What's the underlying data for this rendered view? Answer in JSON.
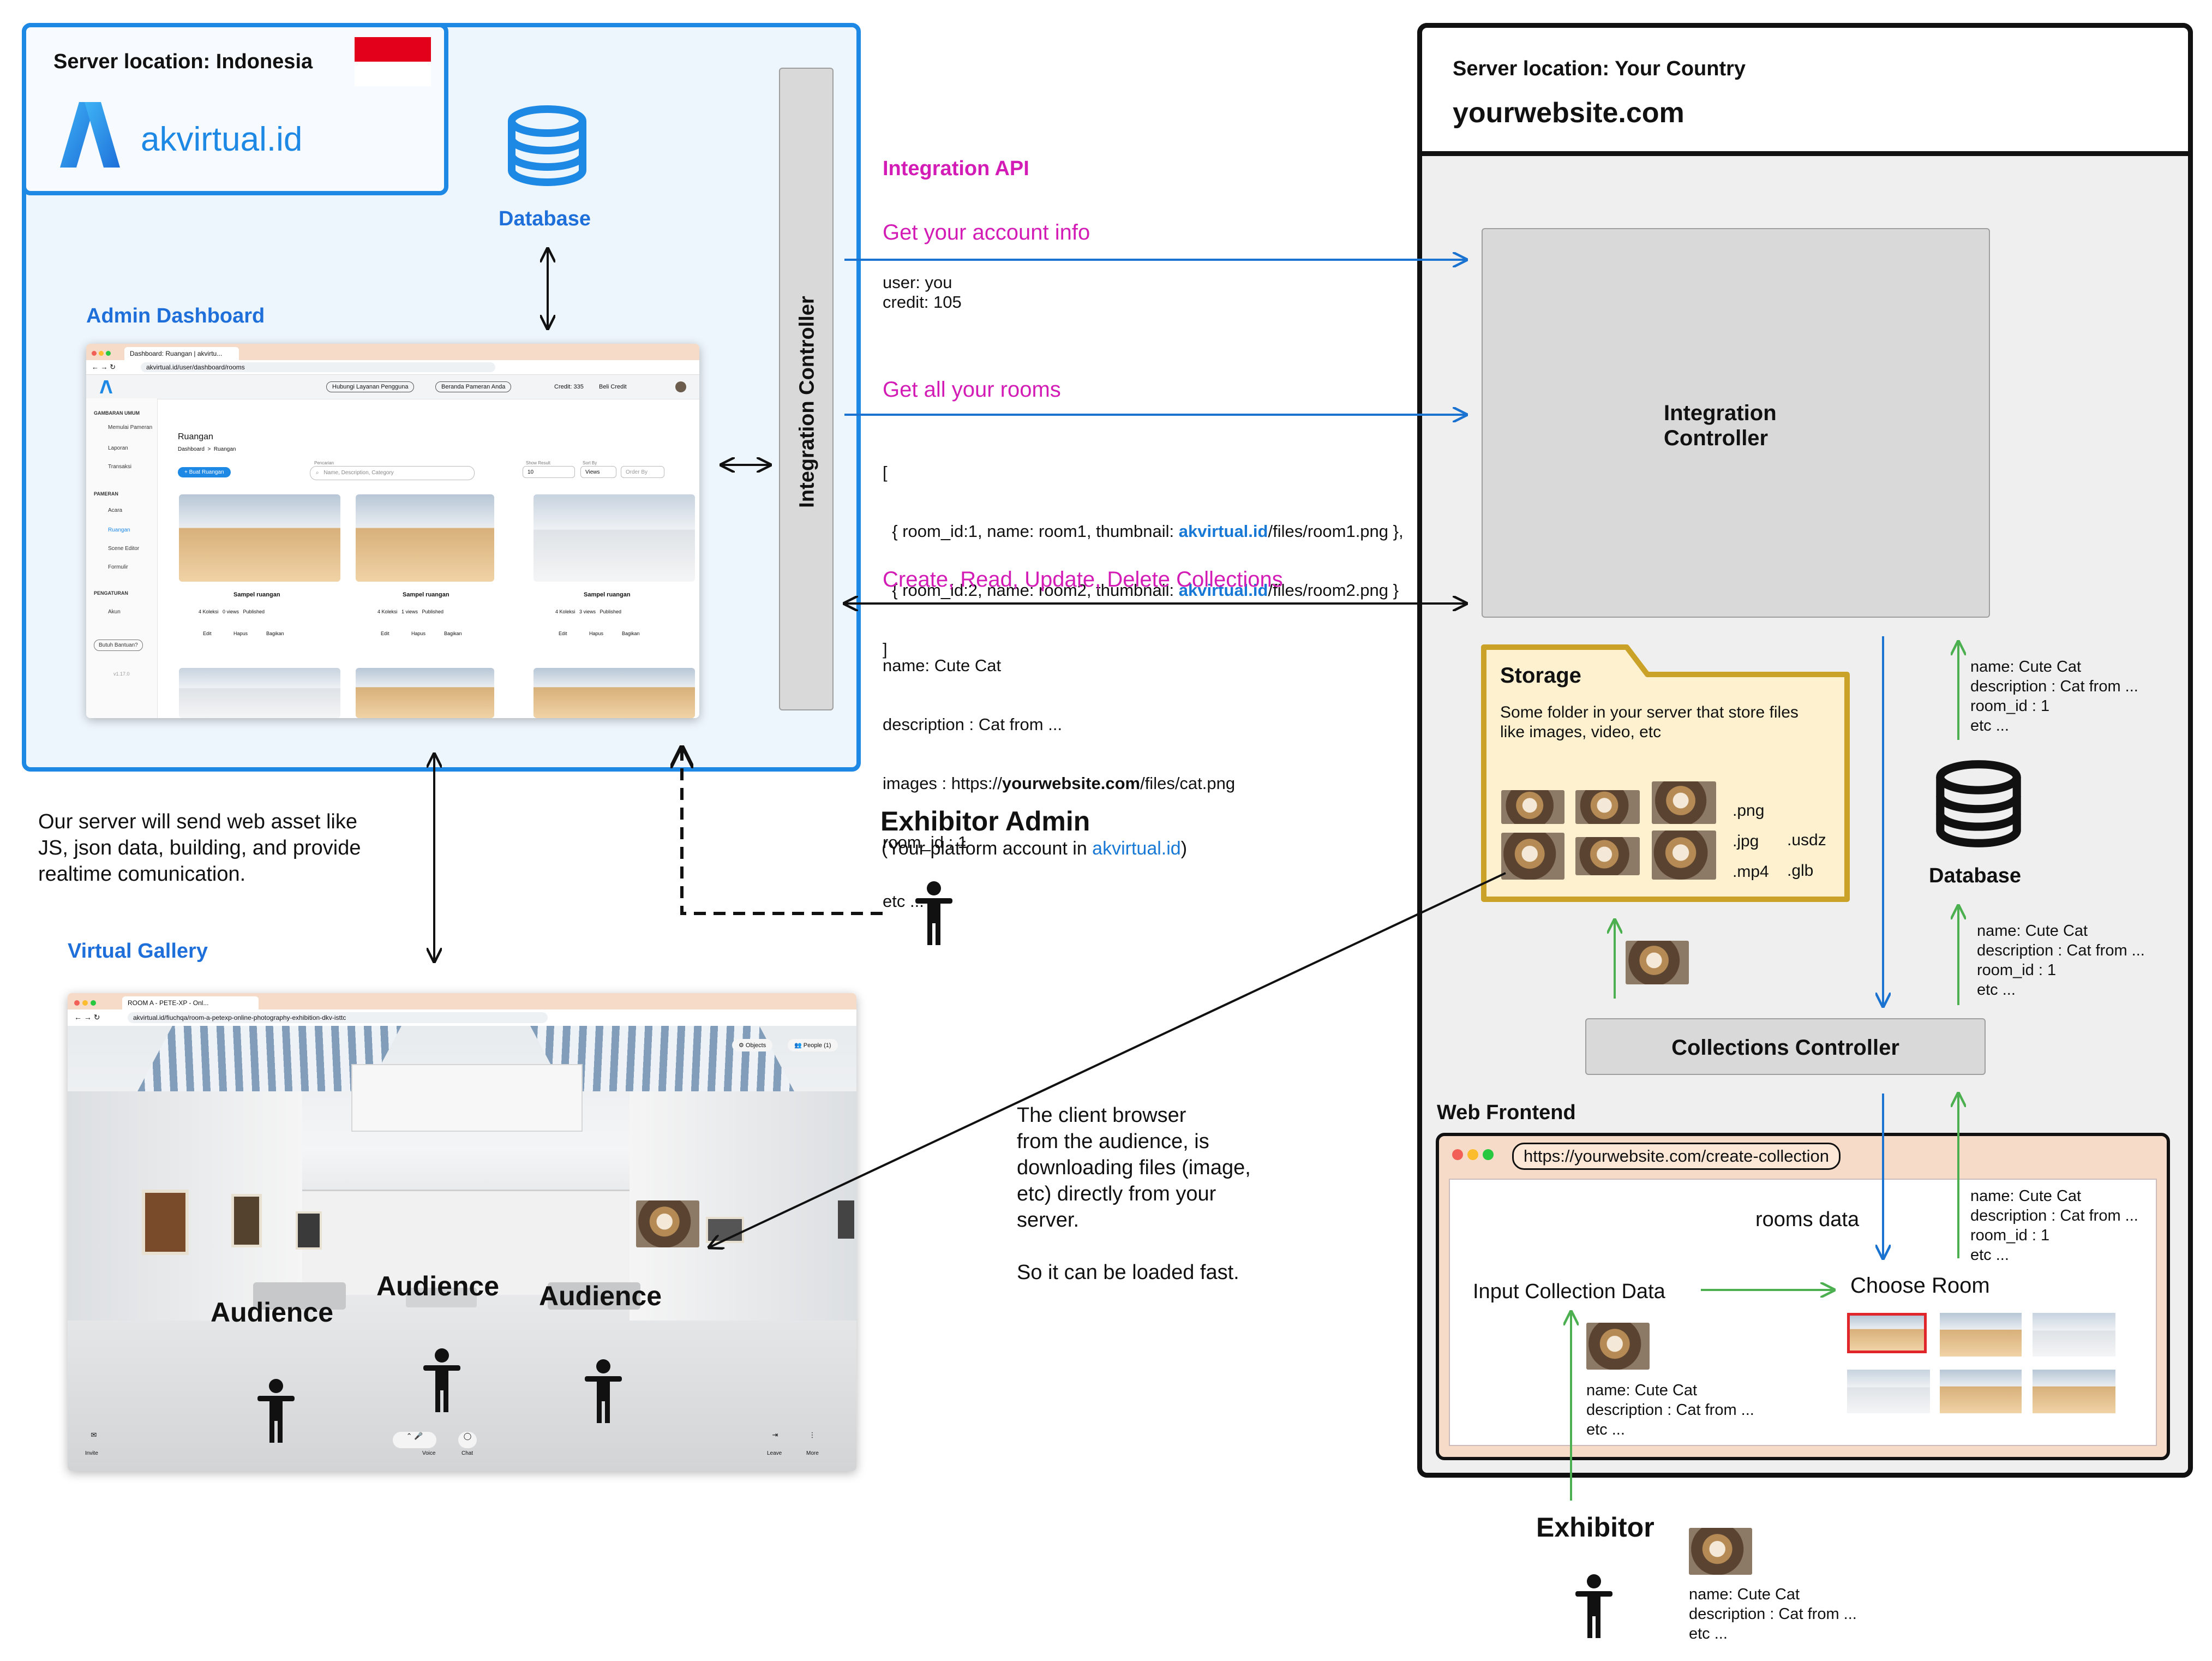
{
  "left_server": {
    "location_label": "Server location: Indonesia",
    "brand": "akvirtual.id",
    "database_label": "Database",
    "admin_dashboard_label": "Admin Dashboard",
    "integration_controller_label": "Integration Controller",
    "flag_colors": [
      "#e3001b",
      "#ffffff"
    ]
  },
  "dashboard_screenshot": {
    "tab_title": "Dashboard: Ruangan | akvirtu...",
    "url": "akvirtual.id/user/dashboard/rooms",
    "btn_support": "Hubungi Layanan Pengguna",
    "btn_home": "Beranda Pameran Anda",
    "credit": "Credit: 335",
    "buy_credit": "Beli Credit",
    "sidebar_section1": "GAMBARAN UMUM",
    "sidebar_items1": [
      "Memulai Pameran",
      "Laporan",
      "Transaksi"
    ],
    "sidebar_section2": "PAMERAN",
    "sidebar_items2": [
      "Acara",
      "Ruangan",
      "Scene Editor",
      "Formulir"
    ],
    "sidebar_section3": "PENGATURAN",
    "sidebar_items3": [
      "Akun"
    ],
    "help_btn": "Butuh Bantuan?",
    "version": "v1.17.0",
    "page_title": "Ruangan",
    "breadcrumb": "Dashboard  >  Ruangan",
    "new_room_btn": "+ Buat Ruangan",
    "search_placeholder": "Name, Description, Category",
    "search_label": "Pencarian",
    "show_result_label": "Show Result",
    "show_result_value": "10",
    "sort_label": "Sort By",
    "sort_value": "Views",
    "order_value": "Order By",
    "cards": [
      {
        "title": "Sampel ruangan",
        "meta": "4 Koleksi   0 views   Published"
      },
      {
        "title": "Sampel ruangan",
        "meta": "4 Koleksi   1 views   Published"
      },
      {
        "title": "Sampel ruangan",
        "meta": "4 Koleksi   3 views   Published"
      }
    ],
    "card_actions": [
      "Edit",
      "Hapus",
      "Bagikan"
    ]
  },
  "right_server": {
    "location_label": "Server location: Your Country",
    "site": "yourwebsite.com",
    "integration_controller_label": "Integration\nController",
    "storage_title": "Storage",
    "storage_desc": "Some folder in your server that store files\nlike images, video, etc",
    "storage_exts_col1": ".png\n.jpg\n.mp4",
    "storage_exts_col2": ".usdz\n.glb",
    "database_label": "Database",
    "collections_controller_label": "Collections Controller",
    "web_frontend_label": "Web Frontend",
    "frontend_url": "https://yourwebsite.com/create-collection",
    "rooms_data_label": "rooms data",
    "input_collection_label": "Input Collection Data",
    "choose_room_label": "Choose Room",
    "collection_sample_inner": "name: Cute Cat\ndescription : Cat from ...\netc ...",
    "collection_sample_db1": "name: Cute Cat\ndescription : Cat from ...\nroom_id : 1\netc ...",
    "collection_sample_db2": "name: Cute Cat\ndescription : Cat from ...\nroom_id : 1\netc ...",
    "collection_sample_room": "name: Cute Cat\ndescription : Cat from ...\nroom_id : 1\netc ..."
  },
  "api": {
    "title": "Integration API",
    "get_account": "Get your account info",
    "account_response": "user: you\ncredit: 105",
    "get_rooms": "Get all your rooms",
    "rooms_line0": "[",
    "rooms_line1_a": "  { room_id:1, name: room1, thumbnail: ",
    "rooms_line1_b": "akvirtual.id",
    "rooms_line1_c": "/files/room1.png },",
    "rooms_line2_a": "  { room_id:2, name: room2, thumbnail: ",
    "rooms_line2_b": "akvirtual.id",
    "rooms_line2_c": "/files/room2.png }",
    "rooms_line3": "]",
    "crud": "Create, Read, Update, Delete Collections",
    "crud_line1": "name: Cute Cat",
    "crud_line2": "description : Cat from ...",
    "crud_line3_a": "images : https://",
    "crud_line3_b": "yourwebsite.com",
    "crud_line3_c": "/files/cat.png",
    "crud_line4": "room_id : 1",
    "crud_line5": "etc ..."
  },
  "exhibitor_admin": {
    "title": "Exhibitor Admin",
    "subtitle_a": "(Your platform account in ",
    "subtitle_b": "akvirtual.id",
    "subtitle_c": ")"
  },
  "server_note": "Our server will send web asset like\nJS, json data, building, and provide\nrealtime comunication.",
  "virtual_gallery": {
    "label": "Virtual Gallery",
    "tab_title": "ROOM A - PETE-XP - Onl...",
    "url": "akvirtual.id/fiuchqa/room-a-petexp-online-photography-exhibition-dkv-isttc",
    "objects_btn": "Objects",
    "people_btn": "People (1)",
    "bottom_left": "Invite",
    "bottom_center": [
      "Voice",
      "Chat"
    ],
    "bottom_right": [
      "Leave",
      "More"
    ],
    "audience": [
      "Audience",
      "Audience",
      "Audience"
    ]
  },
  "client_note": "The client browser\nfrom the audience, is\ndownloading files (image,\netc) directly from your\nserver.\n\nSo it can be loaded fast.",
  "exhibitor": {
    "title": "Exhibitor",
    "sample": "name: Cute Cat\ndescription : Cat from ...\netc ..."
  },
  "colors": {
    "left_border": "#1e88e5",
    "left_bg": "#eef6fd",
    "api_arrow": "#1a73d0",
    "green_arrow": "#4caf50",
    "storage_border": "#c9a227",
    "storage_bg": "#fdf1cf",
    "magenta": "#d31bb6"
  }
}
